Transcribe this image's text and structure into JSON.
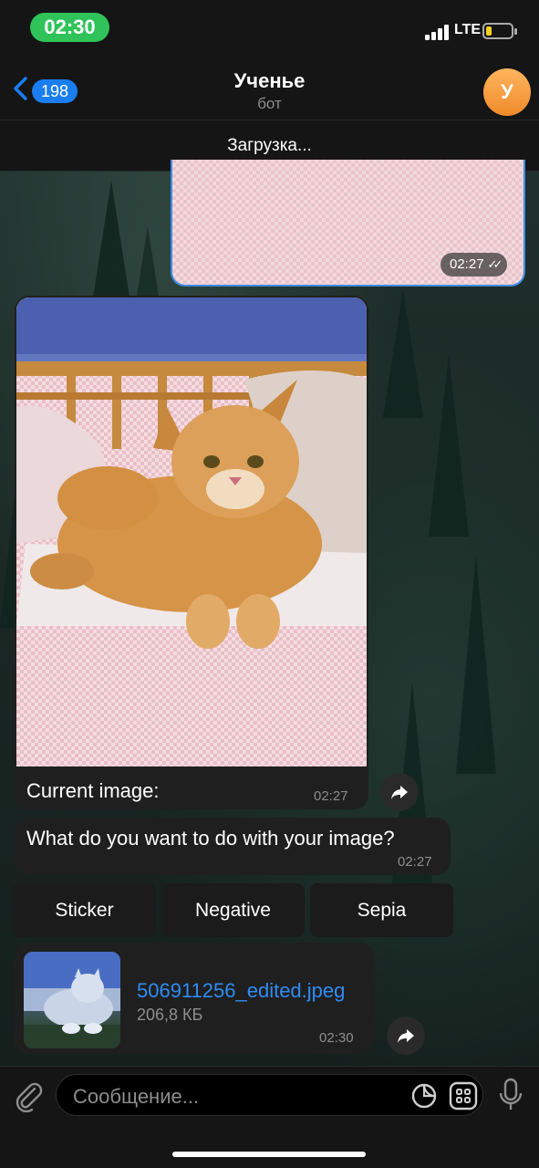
{
  "status_bar": {
    "time": "02:30",
    "network": "LTE"
  },
  "header": {
    "back_count": "198",
    "title": "Ученье",
    "subtitle": "бот",
    "avatar_letter": "У"
  },
  "loading_text": "Загрузка...",
  "messages": {
    "outgoing_photo": {
      "time": "02:27"
    },
    "photo": {
      "caption": "Current image:",
      "time": "02:27"
    },
    "question": {
      "text": "What do you want to do with your image?",
      "time": "02:27"
    },
    "file": {
      "name": "506911256_edited.jpeg",
      "size": "206,8 КБ",
      "time": "02:30"
    }
  },
  "keyboard": {
    "buttons": [
      "Sticker",
      "Negative",
      "Sepia"
    ]
  },
  "input": {
    "placeholder": "Сообщение..."
  },
  "colors": {
    "accent": "#1a7df0",
    "status_time_bg": "#2fc35a",
    "avatar": "#f39a3a",
    "bubble": "#1f1f1f",
    "link": "#2f8cf5"
  }
}
